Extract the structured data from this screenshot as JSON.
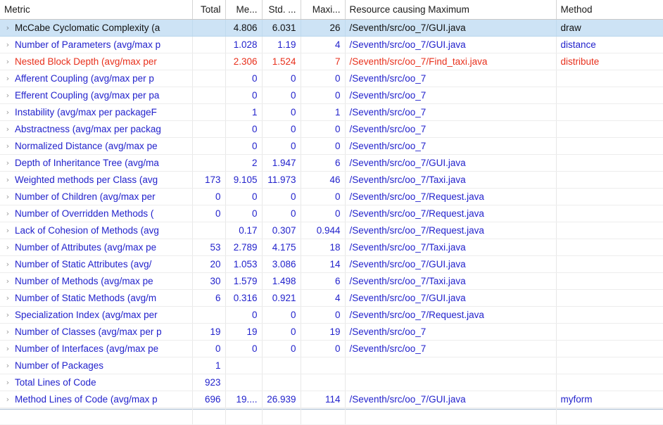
{
  "view": {
    "name": "metrics-table-view"
  },
  "columns": [
    {
      "key": "metric",
      "label": "Metric",
      "align": "left"
    },
    {
      "key": "total",
      "label": "Total",
      "align": "right"
    },
    {
      "key": "mean",
      "label": "Me...",
      "align": "right"
    },
    {
      "key": "std",
      "label": "Std. ...",
      "align": "right"
    },
    {
      "key": "max",
      "label": "Maxi...",
      "align": "right"
    },
    {
      "key": "resource",
      "label": "Resource causing Maximum",
      "align": "left"
    },
    {
      "key": "method",
      "label": "Method",
      "align": "left"
    }
  ],
  "colors": {
    "link_blue": "#2222cc",
    "alert_red": "#e8301c",
    "selection_blue": "#cde3f5",
    "chevron_grey": "#9a9a9a"
  },
  "icons": {
    "expand": "›"
  },
  "rows": [
    {
      "metric": "McCabe Cyclomatic Complexity (a",
      "total": "",
      "mean": "4.806",
      "std": "6.031",
      "max": "26",
      "resource": "/Seventh/src/oo_7/GUI.java",
      "method": "draw",
      "state": "selected",
      "color": "black"
    },
    {
      "metric": "Number of Parameters (avg/max p",
      "total": "",
      "mean": "1.028",
      "std": "1.19",
      "max": "4",
      "resource": "/Seventh/src/oo_7/GUI.java",
      "method": "distance",
      "state": "normal",
      "color": "blue"
    },
    {
      "metric": "Nested Block Depth (avg/max per",
      "total": "",
      "mean": "2.306",
      "std": "1.524",
      "max": "7",
      "resource": "/Seventh/src/oo_7/Find_taxi.java",
      "method": "distribute",
      "state": "normal",
      "color": "red"
    },
    {
      "metric": "Afferent Coupling (avg/max per p",
      "total": "",
      "mean": "0",
      "std": "0",
      "max": "0",
      "resource": "/Seventh/src/oo_7",
      "method": "",
      "state": "normal",
      "color": "blue"
    },
    {
      "metric": "Efferent Coupling (avg/max per pa",
      "total": "",
      "mean": "0",
      "std": "0",
      "max": "0",
      "resource": "/Seventh/src/oo_7",
      "method": "",
      "state": "normal",
      "color": "blue"
    },
    {
      "metric": "Instability (avg/max per packageF",
      "total": "",
      "mean": "1",
      "std": "0",
      "max": "1",
      "resource": "/Seventh/src/oo_7",
      "method": "",
      "state": "normal",
      "color": "blue"
    },
    {
      "metric": "Abstractness (avg/max per packag",
      "total": "",
      "mean": "0",
      "std": "0",
      "max": "0",
      "resource": "/Seventh/src/oo_7",
      "method": "",
      "state": "normal",
      "color": "blue"
    },
    {
      "metric": "Normalized Distance (avg/max pe",
      "total": "",
      "mean": "0",
      "std": "0",
      "max": "0",
      "resource": "/Seventh/src/oo_7",
      "method": "",
      "state": "normal",
      "color": "blue"
    },
    {
      "metric": "Depth of Inheritance Tree (avg/ma",
      "total": "",
      "mean": "2",
      "std": "1.947",
      "max": "6",
      "resource": "/Seventh/src/oo_7/GUI.java",
      "method": "",
      "state": "normal",
      "color": "blue"
    },
    {
      "metric": "Weighted methods per Class (avg",
      "total": "173",
      "mean": "9.105",
      "std": "11.973",
      "max": "46",
      "resource": "/Seventh/src/oo_7/Taxi.java",
      "method": "",
      "state": "normal",
      "color": "blue"
    },
    {
      "metric": "Number of Children (avg/max per",
      "total": "0",
      "mean": "0",
      "std": "0",
      "max": "0",
      "resource": "/Seventh/src/oo_7/Request.java",
      "method": "",
      "state": "normal",
      "color": "blue"
    },
    {
      "metric": "Number of Overridden Methods (",
      "total": "0",
      "mean": "0",
      "std": "0",
      "max": "0",
      "resource": "/Seventh/src/oo_7/Request.java",
      "method": "",
      "state": "normal",
      "color": "blue"
    },
    {
      "metric": "Lack of Cohesion of Methods (avg",
      "total": "",
      "mean": "0.17",
      "std": "0.307",
      "max": "0.944",
      "resource": "/Seventh/src/oo_7/Request.java",
      "method": "",
      "state": "normal",
      "color": "blue"
    },
    {
      "metric": "Number of Attributes (avg/max pe",
      "total": "53",
      "mean": "2.789",
      "std": "4.175",
      "max": "18",
      "resource": "/Seventh/src/oo_7/Taxi.java",
      "method": "",
      "state": "normal",
      "color": "blue"
    },
    {
      "metric": "Number of Static Attributes (avg/",
      "total": "20",
      "mean": "1.053",
      "std": "3.086",
      "max": "14",
      "resource": "/Seventh/src/oo_7/GUI.java",
      "method": "",
      "state": "normal",
      "color": "blue"
    },
    {
      "metric": "Number of Methods (avg/max pe",
      "total": "30",
      "mean": "1.579",
      "std": "1.498",
      "max": "6",
      "resource": "/Seventh/src/oo_7/Taxi.java",
      "method": "",
      "state": "normal",
      "color": "blue"
    },
    {
      "metric": "Number of Static Methods (avg/m",
      "total": "6",
      "mean": "0.316",
      "std": "0.921",
      "max": "4",
      "resource": "/Seventh/src/oo_7/GUI.java",
      "method": "",
      "state": "normal",
      "color": "blue"
    },
    {
      "metric": "Specialization Index (avg/max per",
      "total": "",
      "mean": "0",
      "std": "0",
      "max": "0",
      "resource": "/Seventh/src/oo_7/Request.java",
      "method": "",
      "state": "normal",
      "color": "blue"
    },
    {
      "metric": "Number of Classes (avg/max per p",
      "total": "19",
      "mean": "19",
      "std": "0",
      "max": "19",
      "resource": "/Seventh/src/oo_7",
      "method": "",
      "state": "normal",
      "color": "blue"
    },
    {
      "metric": "Number of Interfaces (avg/max pe",
      "total": "0",
      "mean": "0",
      "std": "0",
      "max": "0",
      "resource": "/Seventh/src/oo_7",
      "method": "",
      "state": "normal",
      "color": "blue"
    },
    {
      "metric": "Number of Packages",
      "total": "1",
      "mean": "",
      "std": "",
      "max": "",
      "resource": "",
      "method": "",
      "state": "normal",
      "color": "blue"
    },
    {
      "metric": "Total Lines of Code",
      "total": "923",
      "mean": "",
      "std": "",
      "max": "",
      "resource": "",
      "method": "",
      "state": "normal",
      "color": "blue"
    },
    {
      "metric": "Method Lines of Code (avg/max p",
      "total": "696",
      "mean": "19....",
      "std": "26.939",
      "max": "114",
      "resource": "/Seventh/src/oo_7/GUI.java",
      "method": "myform",
      "state": "normal",
      "color": "blue"
    }
  ],
  "filler_row_count": 1
}
